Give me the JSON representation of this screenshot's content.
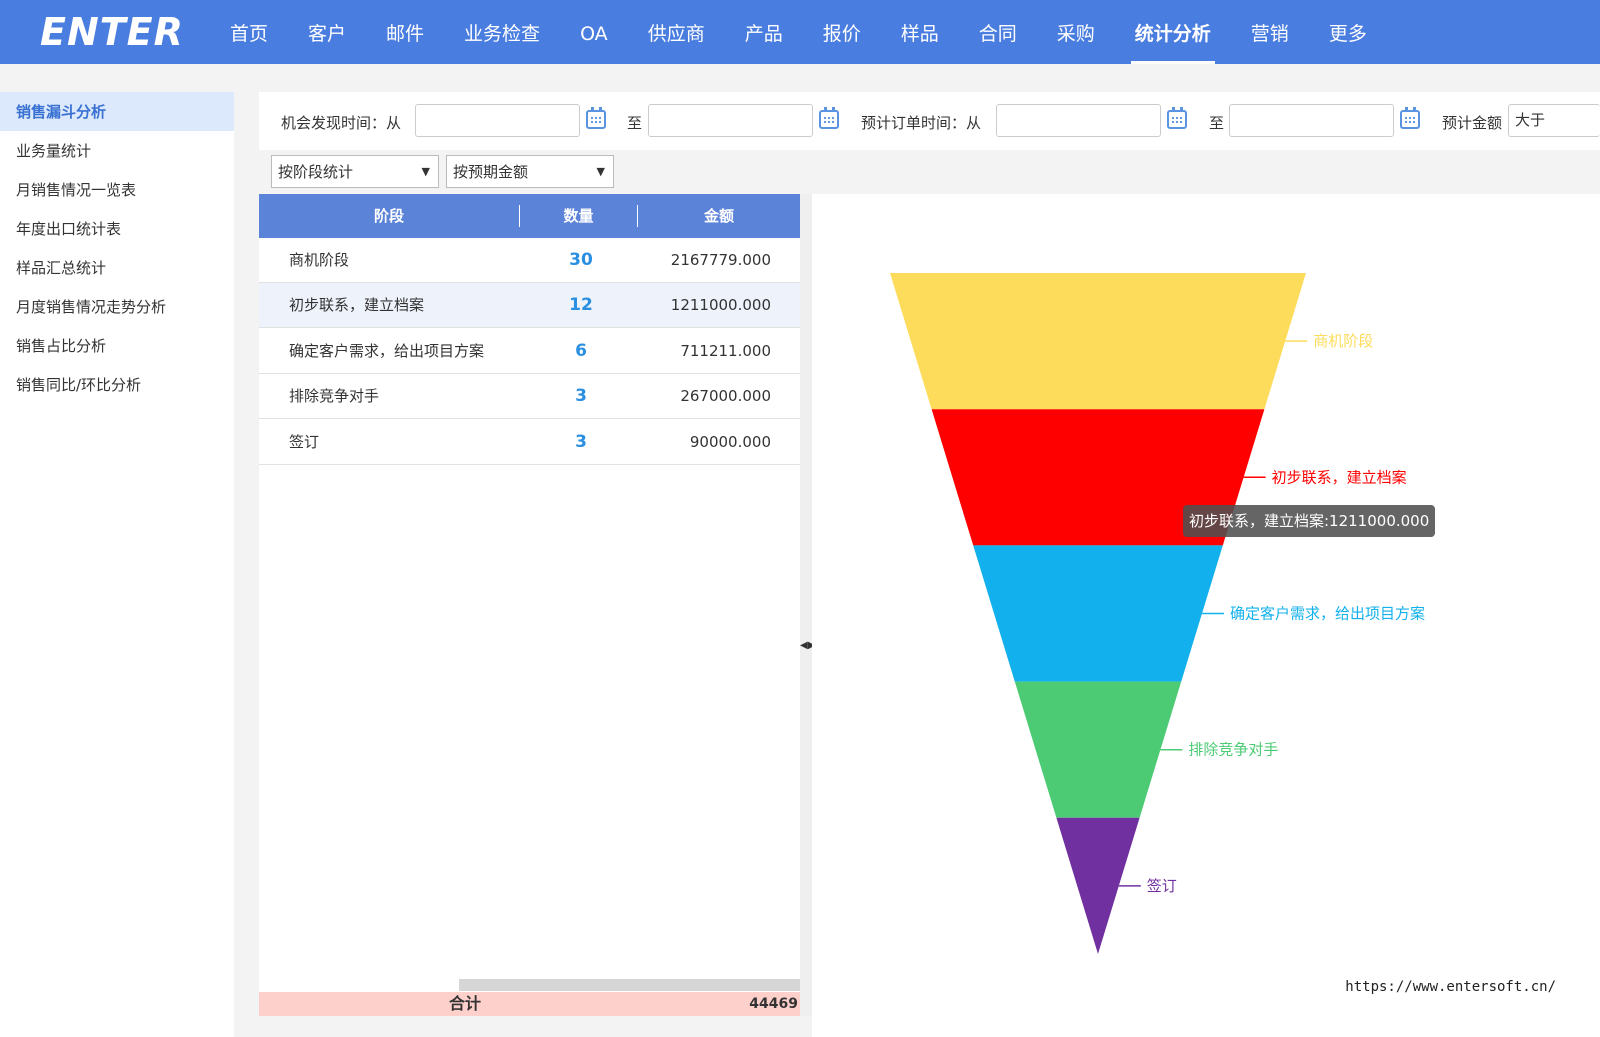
{
  "app": {
    "logo_text": "ENTER",
    "url": "https://www.entersoft.cn/"
  },
  "nav": {
    "items": [
      "首页",
      "客户",
      "邮件",
      "业务检查",
      "OA",
      "供应商",
      "产品",
      "报价",
      "样品",
      "合同",
      "采购",
      "统计分析",
      "营销",
      "更多"
    ],
    "active": "统计分析"
  },
  "sidebar": {
    "items": [
      "销售漏斗分析",
      "业务量统计",
      "月销售情况一览表",
      "年度出口统计表",
      "样品汇总统计",
      "月度销售情况走势分析",
      "销售占比分析",
      "销售同比/环比分析"
    ],
    "active": "销售漏斗分析"
  },
  "filters": {
    "opportunity_label": "机会发现时间：从",
    "to_label_1": "至",
    "order_label": "预计订单时间：从",
    "to_label_2": "至",
    "amount_label": "预计金额",
    "amount_op": "大于",
    "opp_from": "",
    "opp_to": "",
    "order_from": "",
    "order_to": ""
  },
  "selects": {
    "group_by": "按阶段统计",
    "measure": "按预期金额"
  },
  "table": {
    "headers": [
      "阶段",
      "数量",
      "金额"
    ],
    "rows": [
      {
        "stage": "商机阶段",
        "count": "30",
        "amount": "2167779.000"
      },
      {
        "stage": "初步联系，建立档案",
        "count": "12",
        "amount": "1211000.000"
      },
      {
        "stage": "确定客户需求，给出项目方案",
        "count": "6",
        "amount": "711211.000"
      },
      {
        "stage": "排除竞争对手",
        "count": "3",
        "amount": "267000.000"
      },
      {
        "stage": "签订",
        "count": "3",
        "amount": "90000.000"
      }
    ],
    "total_label": "合计",
    "total_value": "44469"
  },
  "chart_data": {
    "type": "funnel",
    "categories": [
      "商机阶段",
      "初步联系，建立档案",
      "确定客户需求，给出项目方案",
      "排除竞争对手",
      "签订"
    ],
    "values": [
      2167779,
      1211000,
      711211,
      267000,
      90000
    ],
    "colors": [
      "#fddc5c",
      "#ff0000",
      "#12b0ec",
      "#4ccb74",
      "#7030a0"
    ],
    "legend": "labels at right of each segment",
    "tooltip": "初步联系，建立档案:1211000.000"
  }
}
